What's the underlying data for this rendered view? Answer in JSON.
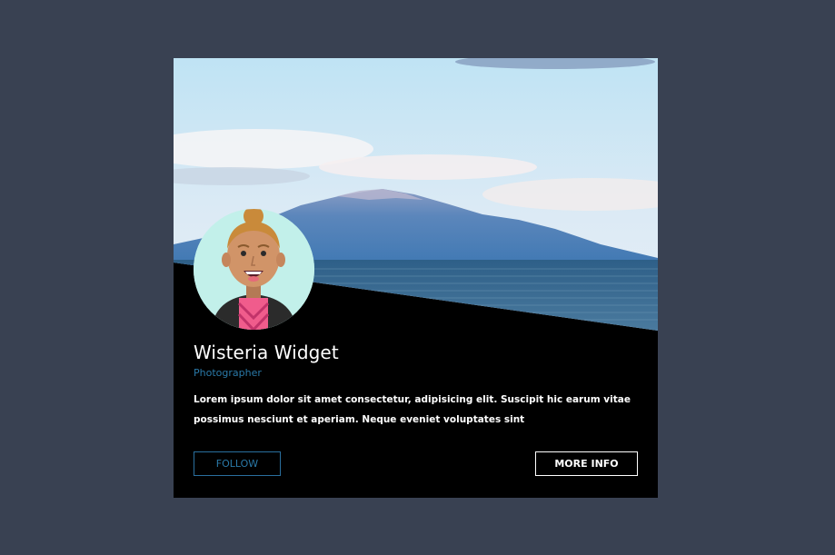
{
  "profile": {
    "name": "Wisteria Widget",
    "role": "Photographer",
    "bio": "Lorem ipsum dolor sit amet consectetur, adipisicing elit. Suscipit hic earum vitae possimus nesciunt et aperiam. Neque eveniet voluptates sint"
  },
  "actions": {
    "follow_label": "FOLLOW",
    "more_info_label": "MORE INFO"
  },
  "colors": {
    "page_background": "#394152",
    "card_background": "#000000",
    "accent": "#2a79a8",
    "text": "#ffffff"
  },
  "icons": {
    "avatar": "person-avatar-illustration",
    "cover": "mountain-lake-photo"
  }
}
